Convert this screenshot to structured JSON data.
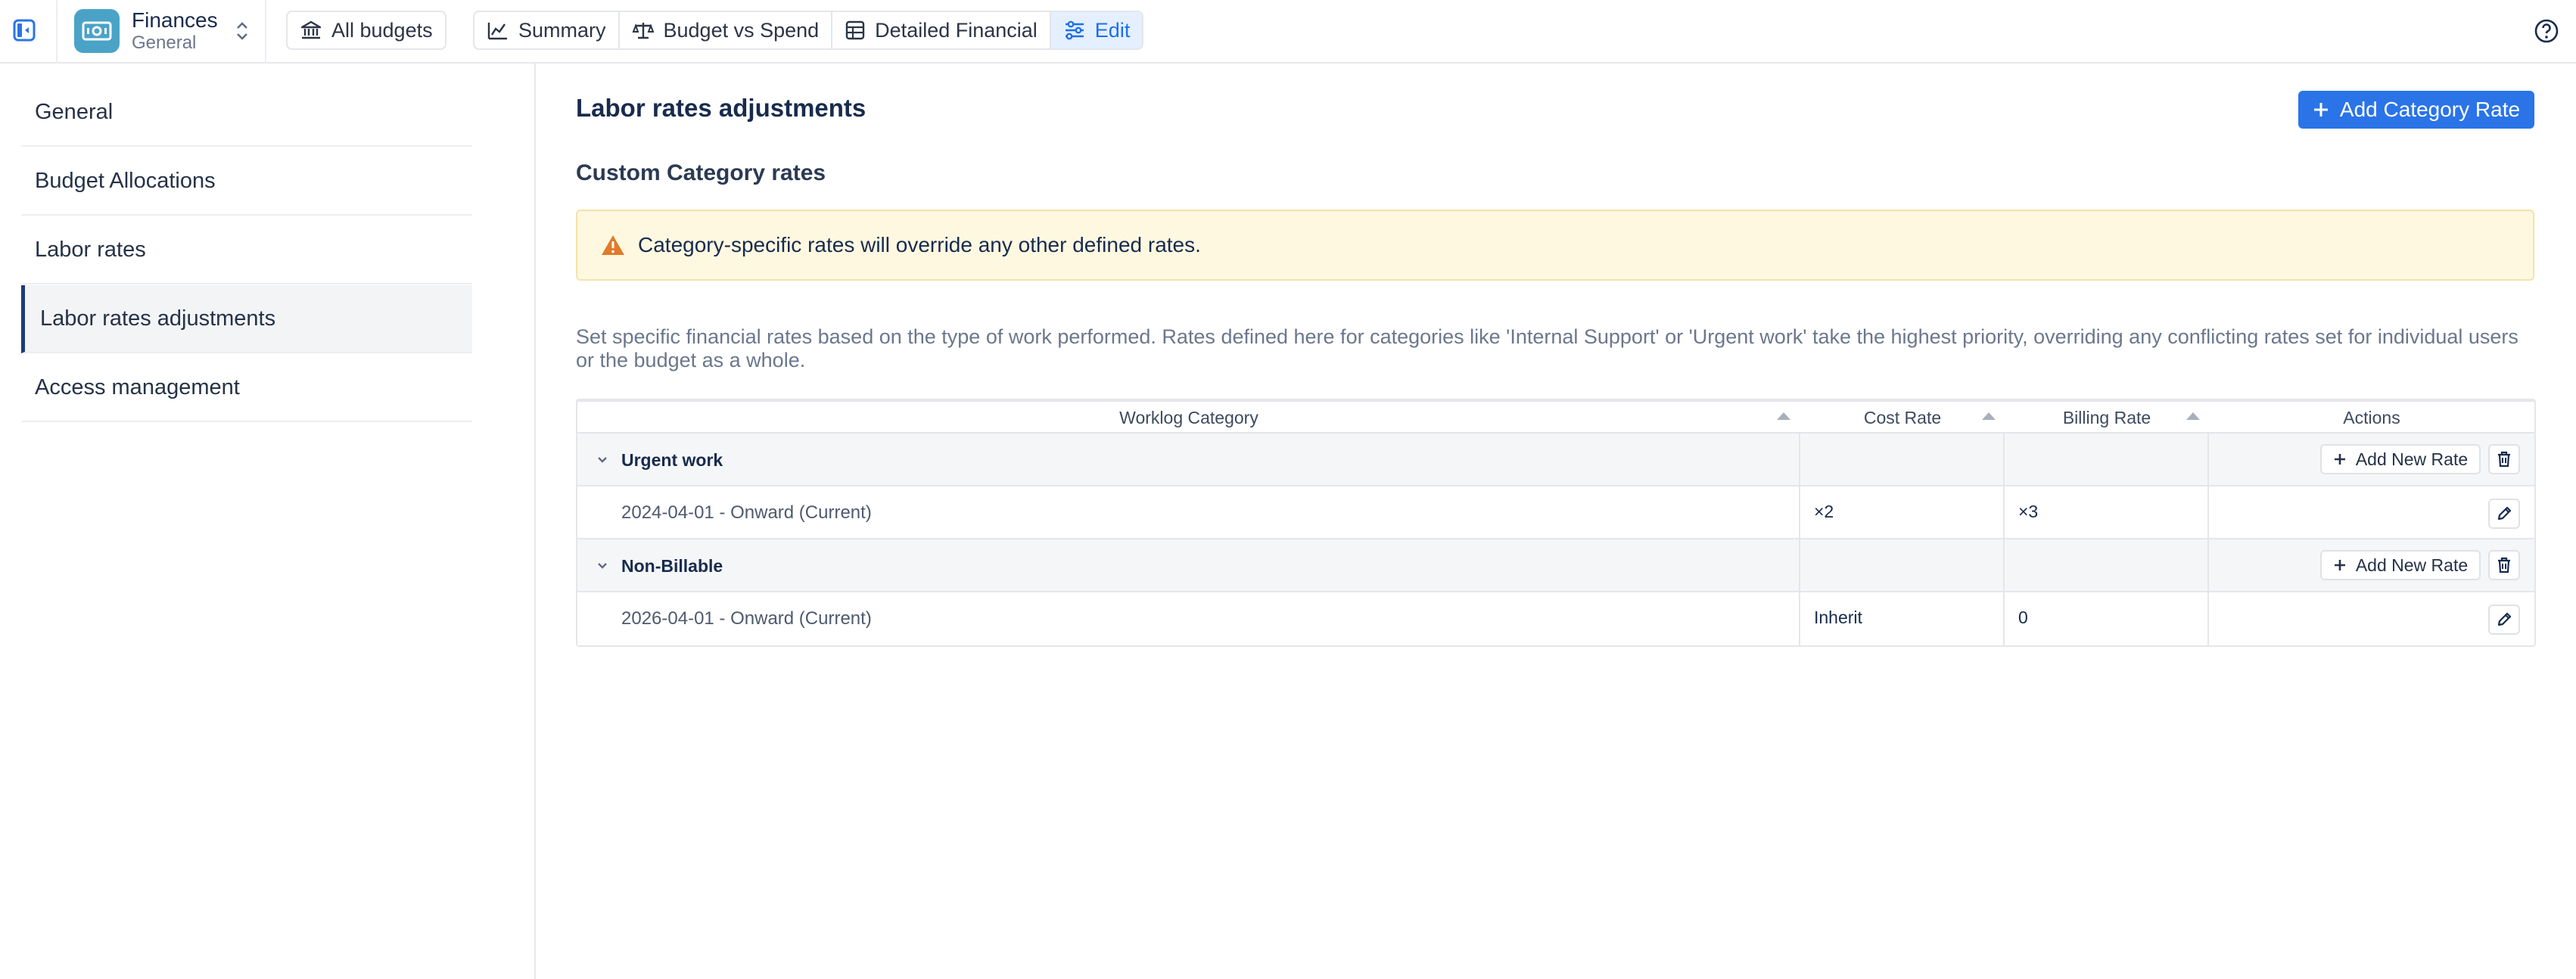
{
  "app": {
    "title": "Finances",
    "subtitle": "General"
  },
  "toolbar": {
    "all_budgets": "All budgets",
    "tabs": [
      {
        "label": "Summary",
        "icon": "chart-line-icon"
      },
      {
        "label": "Budget vs Spend",
        "icon": "scale-icon"
      },
      {
        "label": "Detailed Financial",
        "icon": "table-icon"
      },
      {
        "label": "Edit",
        "icon": "sliders-icon",
        "active": true
      }
    ]
  },
  "sidebar": {
    "items": [
      {
        "label": "General"
      },
      {
        "label": "Budget Allocations"
      },
      {
        "label": "Labor rates"
      },
      {
        "label": "Labor rates adjustments",
        "active": true
      },
      {
        "label": "Access management"
      }
    ]
  },
  "main": {
    "title": "Labor rates adjustments",
    "add_category_label": "Add Category Rate",
    "section_title": "Custom Category rates",
    "warning": "Category-specific rates will override any other defined rates.",
    "description": "Set specific financial rates based on the type of work performed. Rates defined here for categories like 'Internal Support' or 'Urgent work' take the highest priority, overriding any conflicting rates set for individual users or the budget as a whole."
  },
  "table": {
    "columns": [
      "Worklog Category",
      "Cost Rate",
      "Billing Rate",
      "Actions"
    ],
    "add_rate_label": "Add New Rate",
    "groups": [
      {
        "name": "Urgent work",
        "rates": [
          {
            "period": "2024-04-01 - Onward (Current)",
            "cost": "×2",
            "billing": "×3"
          }
        ]
      },
      {
        "name": "Non-Billable",
        "rates": [
          {
            "period": "2026-04-01 - Onward (Current)",
            "cost": "Inherit",
            "billing": "0"
          }
        ]
      }
    ]
  },
  "colors": {
    "accent": "#2a74e8",
    "active_tab_bg": "#e4efff",
    "warning_bg": "#fff8e1",
    "warning_icon": "#e07b2a",
    "nav_active_border": "#1f3a78"
  }
}
